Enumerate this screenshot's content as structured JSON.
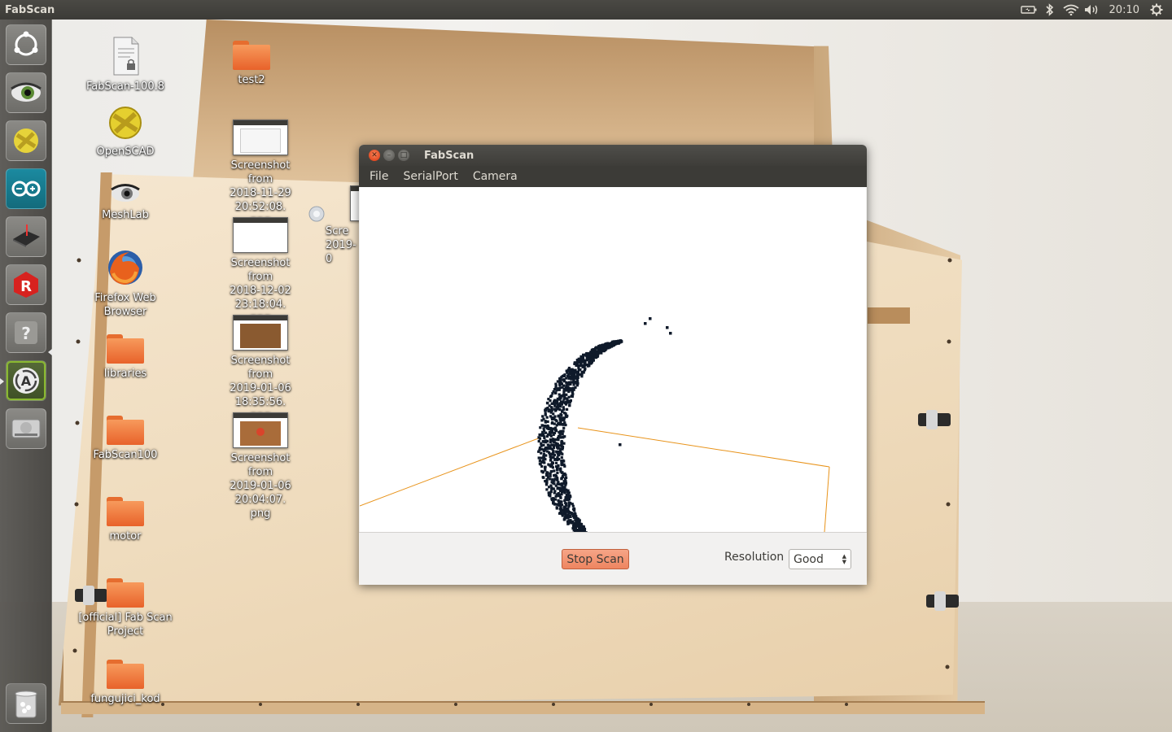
{
  "top_panel": {
    "app_name": "FabScan",
    "clock": "20:10",
    "indicators": [
      "battery-icon",
      "bluetooth-icon",
      "wifi-icon",
      "volume-icon",
      "power-gear-icon"
    ]
  },
  "launcher": {
    "items": [
      {
        "name": "ubuntu-dash-icon"
      },
      {
        "name": "eye-of-gnome-icon"
      },
      {
        "name": "openscad-icon"
      },
      {
        "name": "arduino-icon"
      },
      {
        "name": "laser-cutter-icon"
      },
      {
        "name": "rubygems-icon"
      },
      {
        "name": "help-icon"
      },
      {
        "name": "software-updater-icon"
      },
      {
        "name": "disk-drive-icon"
      },
      {
        "name": "trash-icon"
      }
    ]
  },
  "desktop": {
    "icons": [
      {
        "label": "FabScan-100.8",
        "kind": "file"
      },
      {
        "label": "test2",
        "kind": "folder"
      },
      {
        "label": "OpenSCAD",
        "kind": "app"
      },
      {
        "label": "Screenshot from\n2018-11-29 20:52:08.\npng",
        "kind": "image"
      },
      {
        "label": "MeshLab",
        "kind": "app"
      },
      {
        "label": "Screenshot from\n2018-12-02 23:18:04.\npng",
        "kind": "image"
      },
      {
        "label": "Scre\n2019-0",
        "kind": "image"
      },
      {
        "label": "Firefox Web\nBrowser",
        "kind": "app"
      },
      {
        "label": "Screenshot from\n2019-01-06 18:35:56.\npng",
        "kind": "image"
      },
      {
        "label": "libraries",
        "kind": "folder"
      },
      {
        "label": "Screenshot from\n2019-01-06 20:04:07.\npng",
        "kind": "image"
      },
      {
        "label": "FabScan100",
        "kind": "folder"
      },
      {
        "label": "motor",
        "kind": "folder"
      },
      {
        "label": "[official] Fab Scan\nProject",
        "kind": "folder"
      },
      {
        "label": "fungujici_kod",
        "kind": "folder"
      }
    ]
  },
  "window": {
    "title": "FabScan",
    "menu": [
      "File",
      "SerialPort",
      "Camera"
    ],
    "stop_scan_label": "Stop Scan",
    "resolution_label": "Resolution",
    "resolution_value": "Good",
    "colors": {
      "accent": "#f08a64",
      "scan_line": "#e8931a",
      "point_cloud": "#0f1a2a"
    }
  }
}
